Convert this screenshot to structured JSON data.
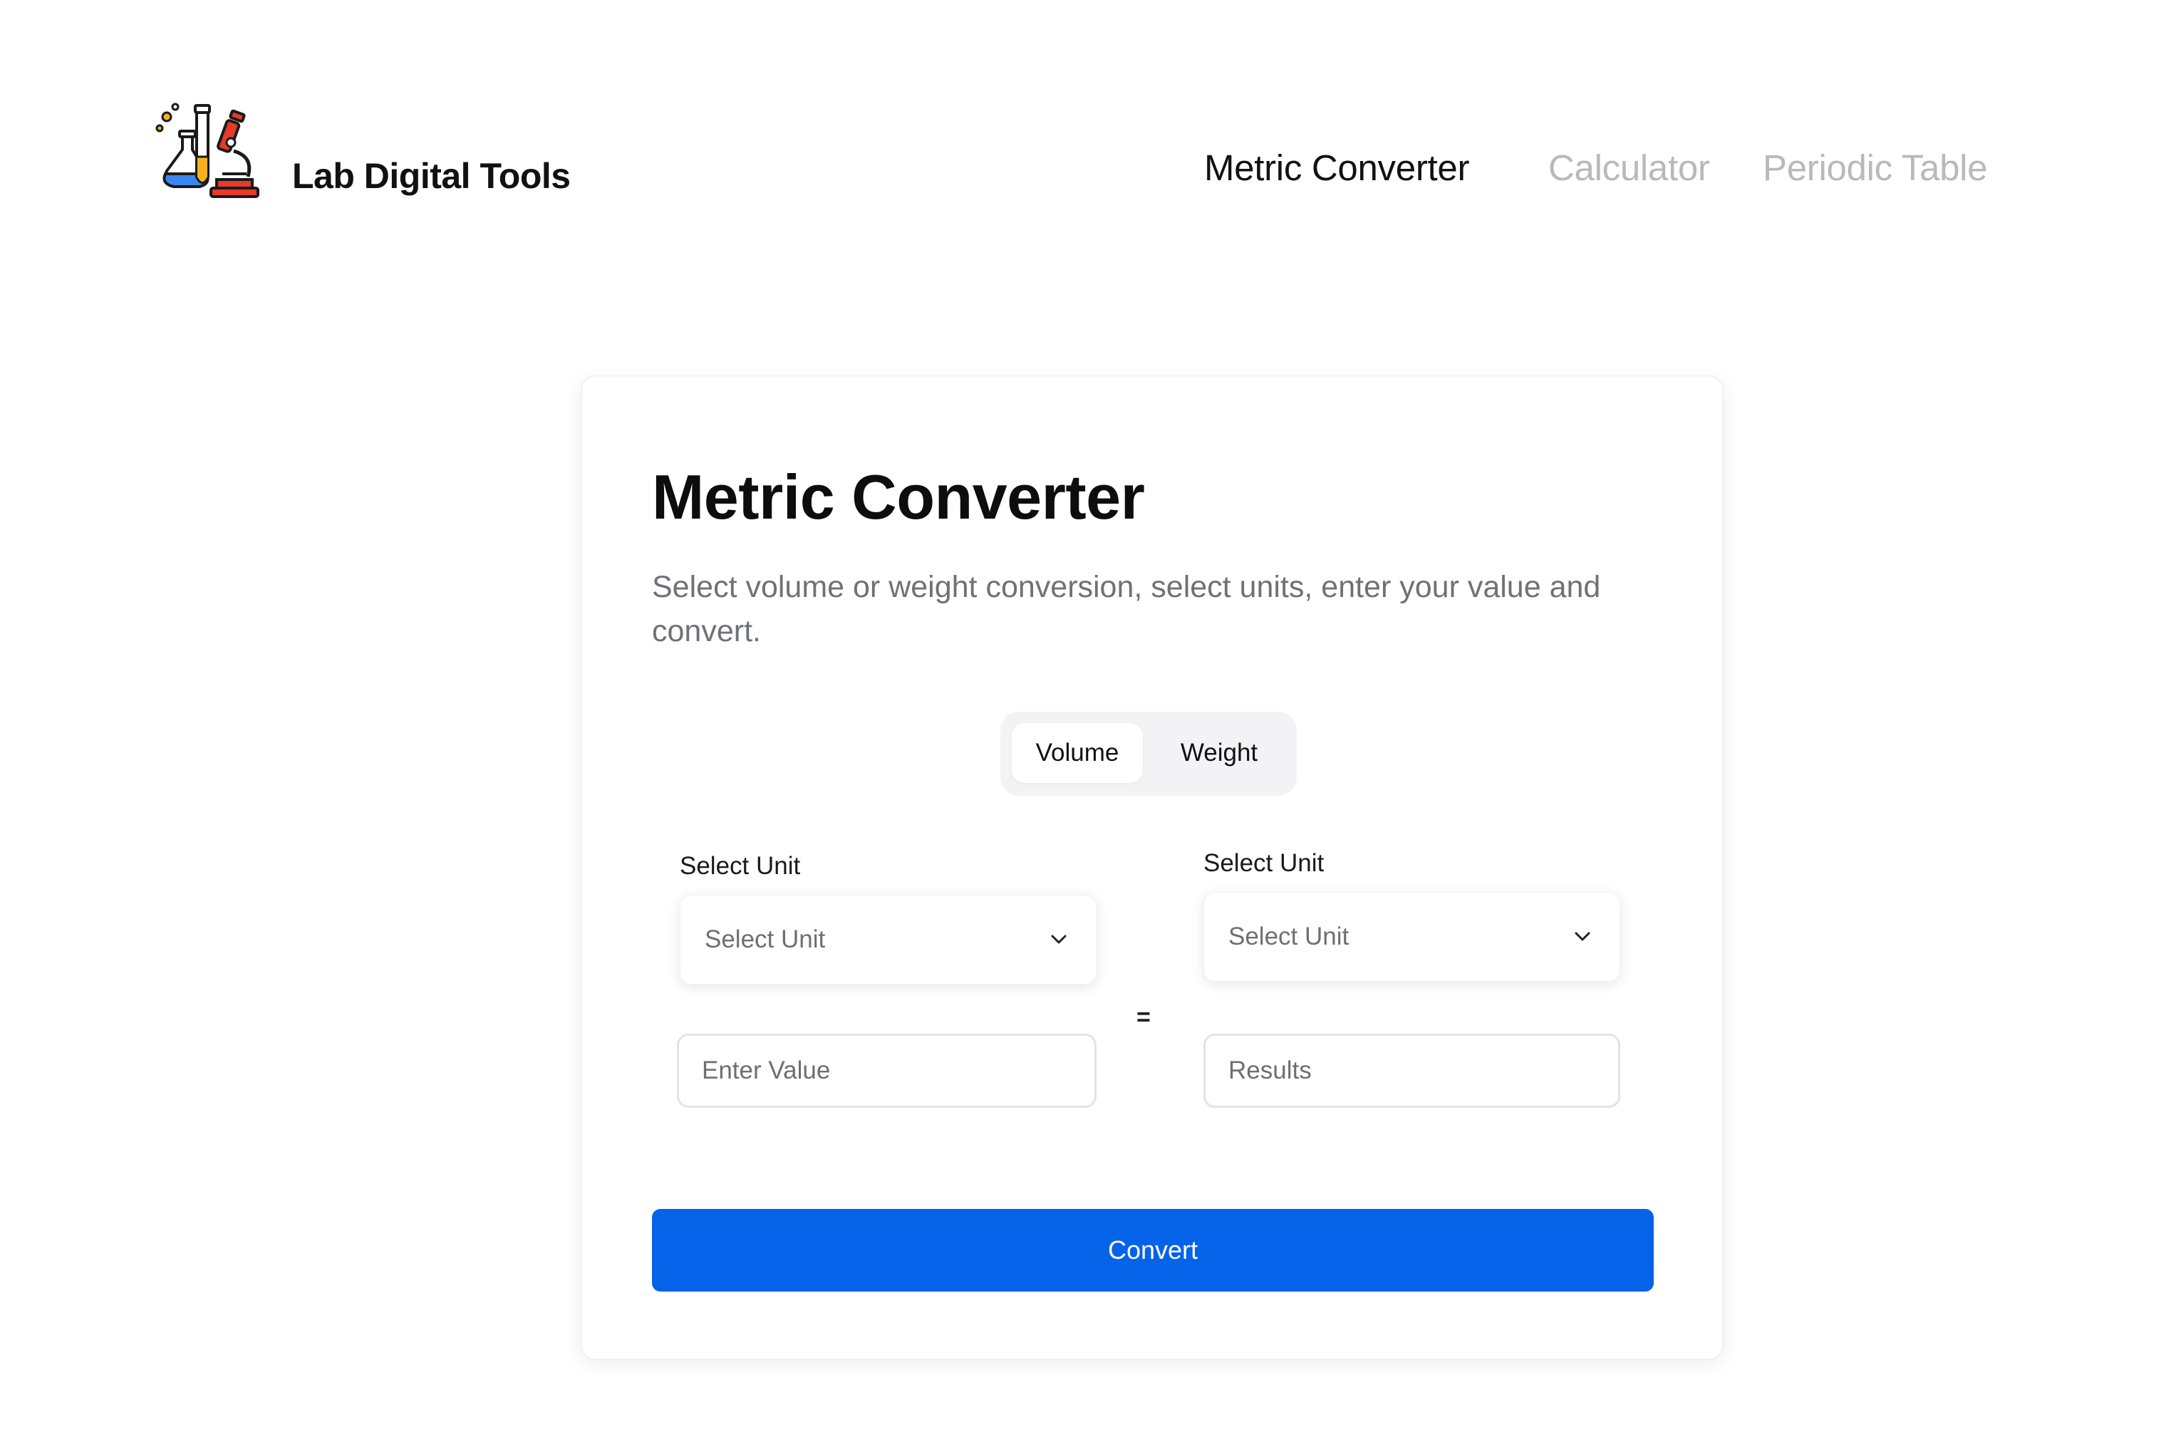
{
  "header": {
    "brand_name": "Lab Digital Tools",
    "logo_icon": "lab-flask-microscope-icon",
    "nav": [
      {
        "label": "Metric Converter",
        "active": true
      },
      {
        "label": "Calculator",
        "active": false
      },
      {
        "label": "Periodic Table",
        "active": false
      }
    ]
  },
  "converter": {
    "title": "Metric Converter",
    "description": "Select volume or weight conversion, select units, enter your value and convert.",
    "modes": [
      "Volume",
      "Weight"
    ],
    "selected_mode": "Volume",
    "from": {
      "label": "Select Unit",
      "select_placeholder": "Select Unit",
      "value_placeholder": "Enter Value"
    },
    "equals_sign": "=",
    "to": {
      "label": "Select Unit",
      "select_placeholder": "Select Unit",
      "result_placeholder": "Results"
    },
    "convert_label": "Convert"
  },
  "colors": {
    "primary": "#0563ea",
    "nav_inactive": "#b9b9bd",
    "text_dark": "#111111",
    "text_muted": "#707078",
    "segment_bg": "#f3f3f5"
  }
}
